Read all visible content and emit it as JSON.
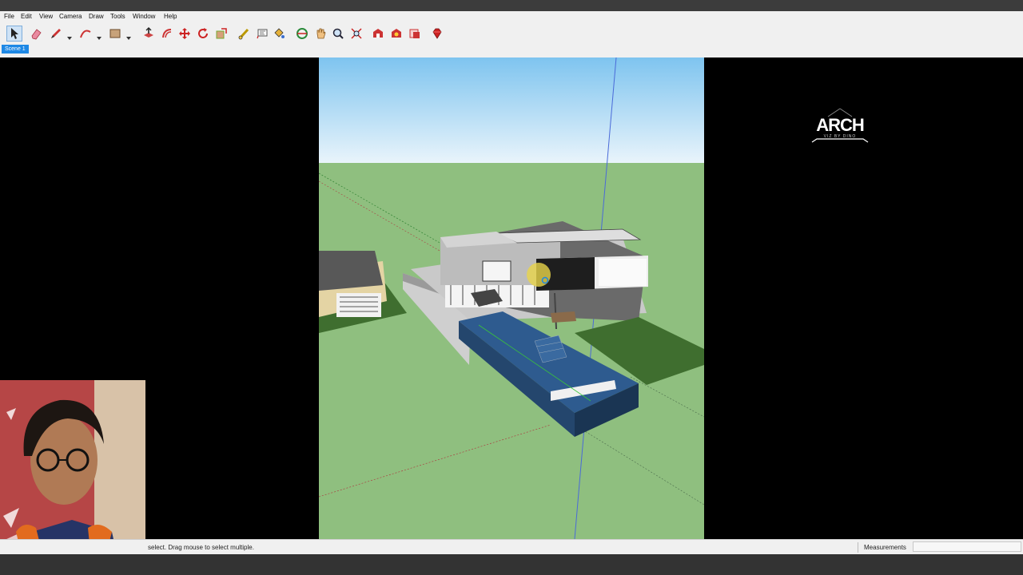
{
  "menu": {
    "items": [
      "File",
      "Edit",
      "View",
      "Camera",
      "Draw",
      "Tools",
      "Window",
      "Help"
    ]
  },
  "toolbar": {
    "tools": [
      {
        "icon": "select-arrow-icon",
        "active": true
      },
      {
        "icon": "eraser-icon"
      },
      {
        "icon": "pencil-line-icon"
      },
      {
        "icon": "arc-icon"
      },
      {
        "icon": "rectangle-icon"
      },
      {
        "icon": "push-pull-icon"
      },
      {
        "icon": "offset-icon"
      },
      {
        "icon": "move-icon"
      },
      {
        "icon": "rotate-icon"
      },
      {
        "icon": "scale-icon"
      },
      {
        "icon": "tape-measure-icon"
      },
      {
        "icon": "text-label-icon"
      },
      {
        "icon": "paint-bucket-icon"
      },
      {
        "icon": "orbit-icon"
      },
      {
        "icon": "pan-icon"
      },
      {
        "icon": "zoom-icon"
      },
      {
        "icon": "zoom-extents-icon"
      },
      {
        "icon": "warehouse-icon"
      },
      {
        "icon": "extension-warehouse-icon"
      },
      {
        "icon": "layout-icon"
      },
      {
        "icon": "ruby-extension-icon"
      }
    ]
  },
  "scenes": {
    "tabs": [
      "Scene 1"
    ]
  },
  "watermark": {
    "text": "ARCH",
    "sub": "VIZ BY DINO"
  },
  "status": {
    "hint": "select. Drag mouse to select multiple.",
    "measurements_label": "Measurements",
    "measurements_value": ""
  },
  "colors": {
    "sky_top": "#7ec4ef",
    "sky_bottom": "#e9f4fb",
    "ground": "#8fbf7f",
    "pool": "#2e5b8f",
    "lawn": "#3f6e2f",
    "chrome": "#f0f0f0",
    "accent": "#1e88e5"
  }
}
